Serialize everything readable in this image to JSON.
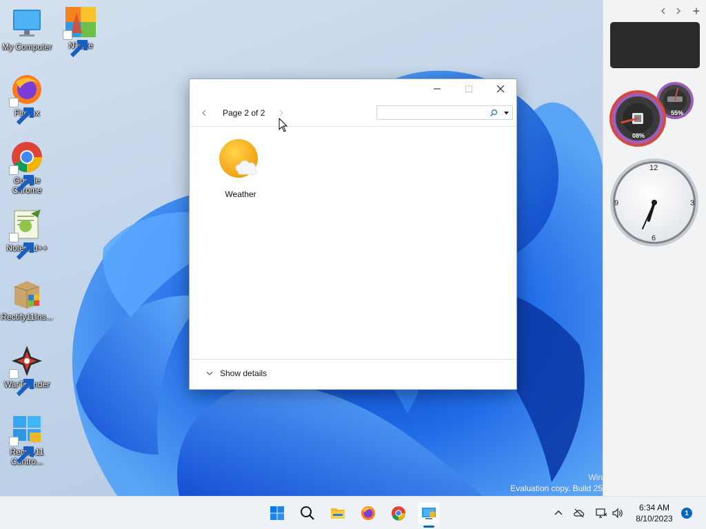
{
  "desktop": {
    "icons": [
      {
        "label": "My Computer",
        "icon": "monitor-icon"
      },
      {
        "label": "NTLite",
        "icon": "ntlite-icon"
      },
      {
        "label": "Firefox",
        "icon": "firefox-icon"
      },
      {
        "label": "Google Chrome",
        "icon": "chrome-icon"
      },
      {
        "label": "Notepad++",
        "icon": "notepadpp-icon"
      },
      {
        "label": "Rectify11Ins...",
        "icon": "installer-box-icon"
      },
      {
        "label": "WarThunder",
        "icon": "warthunder-icon"
      },
      {
        "label": "Rectify11 Contro...",
        "icon": "control-panel-icon"
      }
    ],
    "watermark_line1": "Win",
    "watermark_line2": "Evaluation copy. Build 25"
  },
  "window": {
    "page_label": "Page 2 of 2",
    "search": {
      "placeholder": "",
      "value": ""
    },
    "items": [
      {
        "label": "Weather",
        "icon": "weather-sun-cloud-icon"
      }
    ],
    "details_label": "Show details",
    "controls": {
      "minimize": "minimize-icon",
      "maximize": "maximize-icon",
      "close": "close-icon"
    }
  },
  "sidebar": {
    "controls": [
      "chevron-left-icon",
      "chevron-right-icon",
      "plus-icon"
    ],
    "meter_cpu": "08%",
    "meter_ram": "55%",
    "clock": {
      "n12": "12",
      "n3": "3",
      "n6": "6",
      "n9": "9"
    }
  },
  "taskbar": {
    "apps": [
      "start-icon",
      "search-icon",
      "file-explorer-icon",
      "firefox-icon",
      "chrome-icon",
      "control-panel-icon"
    ],
    "time": "6:34 AM",
    "date": "8/10/2023",
    "notification_count": "1"
  },
  "colors": {
    "accent": "#0067c0",
    "wallpaper_blue": "#1e64e0",
    "meter_red": "#d6493c",
    "meter_purple": "#9b5fb8"
  }
}
